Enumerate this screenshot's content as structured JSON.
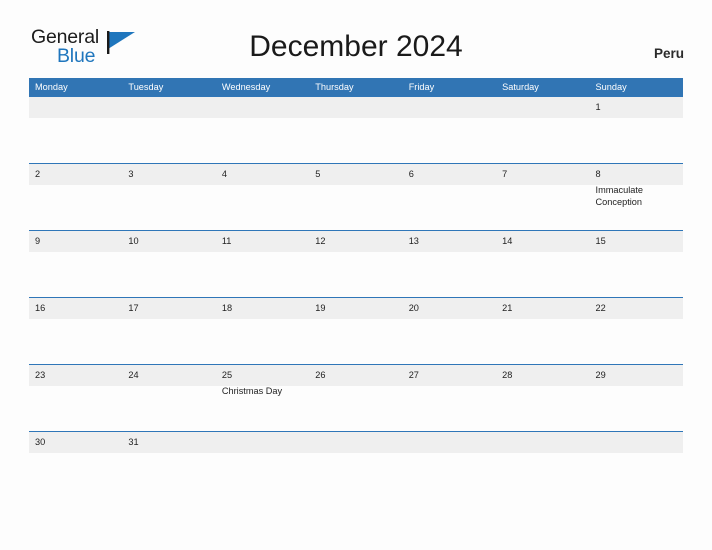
{
  "brand": {
    "name_part1": "General",
    "name_part2": "Blue",
    "flag_icon": "blue-flag-triangle",
    "accent_color": "#1f76bd"
  },
  "header": {
    "title": "December 2024",
    "country": "Peru"
  },
  "theme": {
    "header_bar_color": "#3175b4",
    "row_divider_color": "#2f76b8",
    "date_band_color": "#efefef",
    "page_background": "#fdfdfd",
    "text_color": "#1a1a1a"
  },
  "calendar": {
    "weekdays": [
      "Monday",
      "Tuesday",
      "Wednesday",
      "Thursday",
      "Friday",
      "Saturday",
      "Sunday"
    ],
    "weeks": [
      {
        "days": [
          {
            "num": "",
            "event": ""
          },
          {
            "num": "",
            "event": ""
          },
          {
            "num": "",
            "event": ""
          },
          {
            "num": "",
            "event": ""
          },
          {
            "num": "",
            "event": ""
          },
          {
            "num": "",
            "event": ""
          },
          {
            "num": "1",
            "event": ""
          }
        ]
      },
      {
        "days": [
          {
            "num": "2",
            "event": ""
          },
          {
            "num": "3",
            "event": ""
          },
          {
            "num": "4",
            "event": ""
          },
          {
            "num": "5",
            "event": ""
          },
          {
            "num": "6",
            "event": ""
          },
          {
            "num": "7",
            "event": ""
          },
          {
            "num": "8",
            "event": "Immaculate Conception"
          }
        ]
      },
      {
        "days": [
          {
            "num": "9",
            "event": ""
          },
          {
            "num": "10",
            "event": ""
          },
          {
            "num": "11",
            "event": ""
          },
          {
            "num": "12",
            "event": ""
          },
          {
            "num": "13",
            "event": ""
          },
          {
            "num": "14",
            "event": ""
          },
          {
            "num": "15",
            "event": ""
          }
        ]
      },
      {
        "days": [
          {
            "num": "16",
            "event": ""
          },
          {
            "num": "17",
            "event": ""
          },
          {
            "num": "18",
            "event": ""
          },
          {
            "num": "19",
            "event": ""
          },
          {
            "num": "20",
            "event": ""
          },
          {
            "num": "21",
            "event": ""
          },
          {
            "num": "22",
            "event": ""
          }
        ]
      },
      {
        "days": [
          {
            "num": "23",
            "event": ""
          },
          {
            "num": "24",
            "event": ""
          },
          {
            "num": "25",
            "event": "Christmas Day"
          },
          {
            "num": "26",
            "event": ""
          },
          {
            "num": "27",
            "event": ""
          },
          {
            "num": "28",
            "event": ""
          },
          {
            "num": "29",
            "event": ""
          }
        ]
      },
      {
        "days": [
          {
            "num": "30",
            "event": ""
          },
          {
            "num": "31",
            "event": ""
          },
          {
            "num": "",
            "event": ""
          },
          {
            "num": "",
            "event": ""
          },
          {
            "num": "",
            "event": ""
          },
          {
            "num": "",
            "event": ""
          },
          {
            "num": "",
            "event": ""
          }
        ]
      }
    ]
  }
}
